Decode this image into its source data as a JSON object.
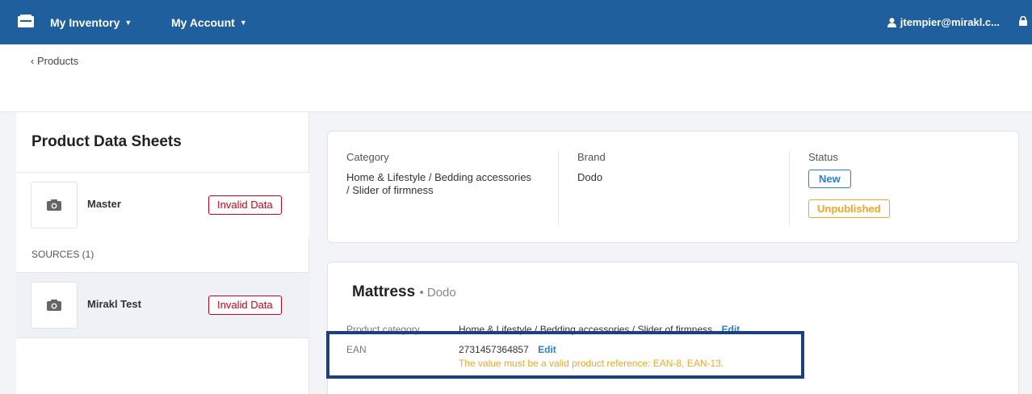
{
  "topbar": {
    "nav": [
      {
        "label": "My Inventory"
      },
      {
        "label": "My Account"
      }
    ],
    "user": "jtempier@mirakl.c..."
  },
  "breadcrumb": "‹ Products",
  "sidebar": {
    "title": "Product Data Sheets",
    "master": {
      "name": "Master",
      "badge": "Invalid Data"
    },
    "sources_label": "SOURCES (1)",
    "source": {
      "name": "Mirakl Test",
      "badge": "Invalid Data"
    }
  },
  "info": {
    "category_label": "Category",
    "category_value": "Home & Lifestyle / Bedding accessories / Slider of firmness",
    "brand_label": "Brand",
    "brand_value": "Dodo",
    "status_label": "Status",
    "status_new": "New",
    "status_unpublished": "Unpublished"
  },
  "product": {
    "title": "Mattress",
    "brand": "• Dodo",
    "category_key": "Product category",
    "category_value": "Home & Lifestyle / Bedding accessories / Slider of firmness",
    "category_edit": "Edit",
    "ean_key": "EAN",
    "ean_value": "2731457364857",
    "ean_edit": "Edit",
    "ean_error": "The value must be a valid product reference: EAN-8, EAN-13."
  },
  "colors": {
    "topbar": "#1f5f9e",
    "invalid": "#d0021b",
    "new": "#2a7de1",
    "unpublished": "#f5a623",
    "highlight": "#1c3f7f"
  }
}
